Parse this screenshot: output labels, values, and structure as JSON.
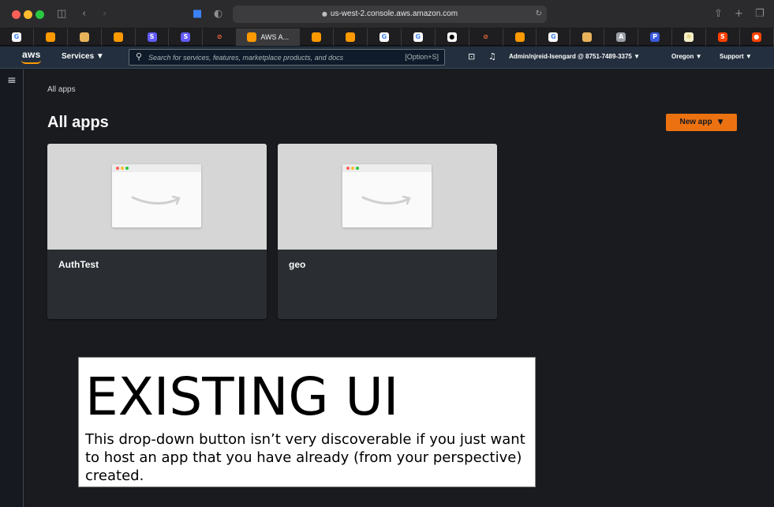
{
  "browser": {
    "url": "us-west-2.console.aws.amazon.com",
    "active_tab_label": "AWS A...",
    "favorite_tabs": [
      {
        "icon": "google-icon",
        "glyph": "G",
        "color": "#ffffff",
        "text_color": "#4285f4"
      },
      {
        "icon": "aws-cube-icon",
        "glyph": "",
        "color": "#ff9900"
      },
      {
        "icon": "aws-box-icon",
        "glyph": "",
        "color": "#e8b35a"
      },
      {
        "icon": "aws-cube-icon",
        "glyph": "",
        "color": "#ff9900"
      },
      {
        "icon": "stripe-icon",
        "glyph": "S",
        "color": "#635bff"
      },
      {
        "icon": "stripe-icon",
        "glyph": "S",
        "color": "#635bff"
      },
      {
        "icon": "blocked-icon",
        "glyph": "⊘",
        "color": "#1e1e20",
        "text_color": "#ff6a3d"
      },
      {
        "icon": "aws-cube-icon",
        "glyph": "",
        "color": "#ff9900",
        "active": true
      },
      {
        "icon": "amplify-icon",
        "glyph": "",
        "color": "#ff9900"
      },
      {
        "icon": "amplify-icon",
        "glyph": "",
        "color": "#ff9900"
      },
      {
        "icon": "google-icon",
        "glyph": "G",
        "color": "#ffffff",
        "text_color": "#4285f4"
      },
      {
        "icon": "google-icon",
        "glyph": "G",
        "color": "#ffffff",
        "text_color": "#4285f4"
      },
      {
        "icon": "github-icon",
        "glyph": "●",
        "color": "#ffffff",
        "text_color": "#000000"
      },
      {
        "icon": "blocked-icon",
        "glyph": "⊘",
        "color": "#1e1e20",
        "text_color": "#ff6a3d"
      },
      {
        "icon": "aws-cube-icon",
        "glyph": "",
        "color": "#ff9900"
      },
      {
        "icon": "google-icon",
        "glyph": "G",
        "color": "#ffffff",
        "text_color": "#4285f4"
      },
      {
        "icon": "aws-box-icon",
        "glyph": "",
        "color": "#e8b35a"
      },
      {
        "icon": "a-icon",
        "glyph": "A",
        "color": "#9aa0a6"
      },
      {
        "icon": "parameter-icon",
        "glyph": "P",
        "color": "#3b5bdb"
      },
      {
        "icon": "sun-icon",
        "glyph": "☼",
        "color": "#f5f0c8",
        "text_color": "#c8a400"
      },
      {
        "icon": "svelte-icon",
        "glyph": "S",
        "color": "#ff3e00"
      },
      {
        "icon": "reddit-icon",
        "glyph": "●",
        "color": "#ff4500"
      }
    ]
  },
  "aws_nav": {
    "logo": "aws",
    "services_label": "Services ▼",
    "search_placeholder": "Search for services, features, marketplace products, and docs",
    "search_shortcut": "[Option+S]",
    "account_label": "Admin/njreid-Isengard @ 8751-7489-3375 ▼",
    "region_label": "Oregon ▼",
    "support_label": "Support ▼"
  },
  "main": {
    "breadcrumb": "All apps",
    "title": "All apps",
    "new_app_label": "New app",
    "apps": [
      {
        "name": "AuthTest"
      },
      {
        "name": "geo"
      }
    ]
  },
  "annotation": {
    "title": "EXISTING UI",
    "body": "This drop-down button isn’t very discoverable if you just want to host an app that you have already (from your perspective) created."
  }
}
